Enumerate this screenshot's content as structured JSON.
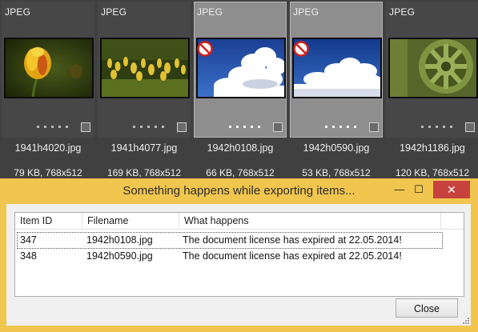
{
  "thumbnails": [
    {
      "format": "JPEG",
      "filename": "1941h4020.jpg",
      "info": "79 KB, 768x512",
      "selected": false,
      "blocked": false,
      "image": "yellow-tulip"
    },
    {
      "format": "JPEG",
      "filename": "1941h4077.jpg",
      "info": "169 KB, 768x512",
      "selected": false,
      "blocked": false,
      "image": "tulip-field"
    },
    {
      "format": "JPEG",
      "filename": "1942h0108.jpg",
      "info": "66 KB, 768x512",
      "selected": true,
      "blocked": true,
      "image": "clouds"
    },
    {
      "format": "JPEG",
      "filename": "1942h0590.jpg",
      "info": "53 KB, 768x512",
      "selected": true,
      "blocked": true,
      "image": "clouds"
    },
    {
      "format": "JPEG",
      "filename": "1942h1186.jpg",
      "info": "120 KB, 768x512",
      "selected": false,
      "blocked": false,
      "image": "green-gear"
    }
  ],
  "dialog": {
    "title": "Something happens while exporting items...",
    "window_buttons": {
      "minimize": "—",
      "maximize": "☐",
      "close": "✕"
    },
    "columns": [
      "Item ID",
      "Filename",
      "What happens"
    ],
    "rows": [
      {
        "id": "347",
        "filename": "1942h0108.jpg",
        "what": "The document license has expired at 22.05.2014!"
      },
      {
        "id": "348",
        "filename": "1942h0590.jpg",
        "what": "The document license has expired at 22.05.2014!"
      }
    ],
    "close_label": "Close"
  },
  "colors": {
    "dialog_bg": "#f0c64e",
    "strip_bg": "#404040",
    "selected_tile": "#8e8e8e",
    "close_button": "#c7423f"
  }
}
